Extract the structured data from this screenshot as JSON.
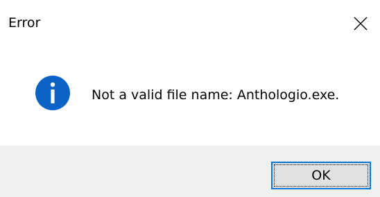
{
  "window": {
    "title": "Error"
  },
  "icons": {
    "close": "close-icon",
    "status": "info-icon"
  },
  "message": {
    "text": "Not a valid file name: Anthologio.exe."
  },
  "buttons": {
    "ok_label": "OK"
  },
  "colors": {
    "accent": "#0078d7",
    "footer_bg": "#f0f0f0",
    "button_bg": "#e1e1e1",
    "info_icon": "#0b63c6"
  }
}
